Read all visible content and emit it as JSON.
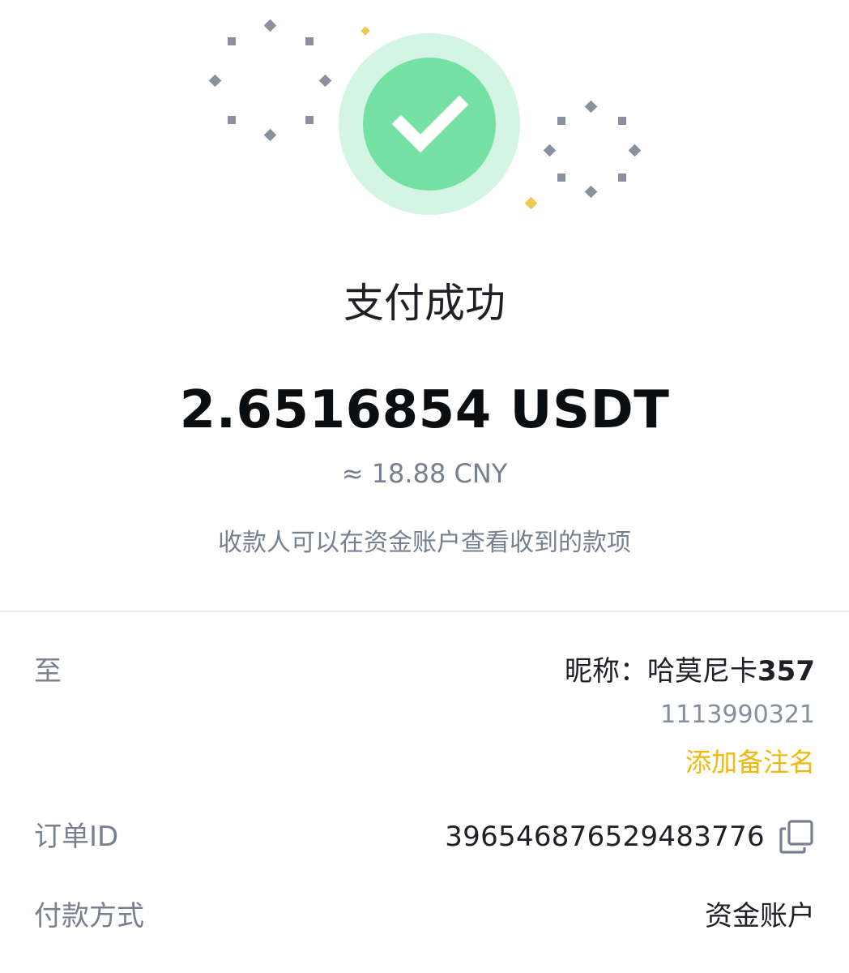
{
  "status": {
    "title": "支付成功",
    "icon": "check-icon",
    "success_color": "#74e1a3",
    "halo_color": "#d4f5e3",
    "accent_color": "#f0b90b"
  },
  "payment": {
    "amount": "2.6516854 USDT",
    "approx_value": "≈ 18.88 CNY",
    "note": "收款人可以在资金账户查看收到的款项"
  },
  "details": {
    "recipient": {
      "label": "至",
      "nickname_prefix": "昵称：哈莫尼卡",
      "nickname_suffix": "357",
      "user_id": "1113990321",
      "add_remark": "添加备注名"
    },
    "order": {
      "label": "订单ID",
      "value": "396546876529483776",
      "copy_icon": "copy-icon"
    },
    "method": {
      "label": "付款方式",
      "value": "资金账户"
    }
  }
}
